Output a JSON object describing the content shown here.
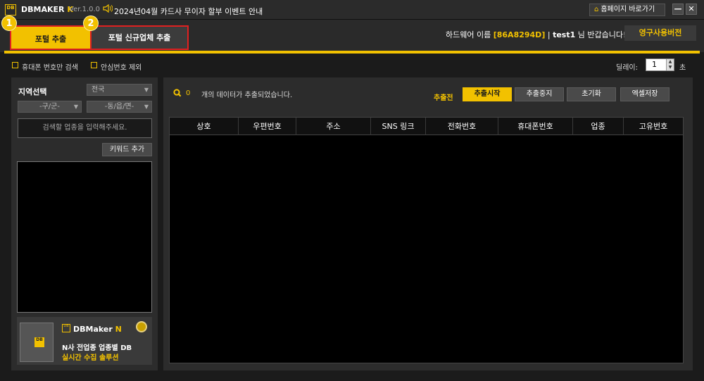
{
  "titlebar": {
    "logo": "DB",
    "app_name_prefix": "DBMAKER ",
    "app_name_suffix": "K",
    "version": "Ver.1.0.0",
    "notice_icon": "speaker-icon",
    "notice": "2024년04월 카드사 무이자 할부 이벤트 안내",
    "home_button": "홈페이지 바로가기",
    "minimize": "—",
    "close": "✕"
  },
  "tabs": {
    "extract_label": "포털 추출",
    "new_company_label": "포털 신규업체 추출",
    "badge1": "1",
    "badge2": "2"
  },
  "hardware": {
    "label": "하드웨어 이름",
    "id": "[86A8294D]",
    "separator": "|",
    "user": "test1",
    "greeting": "님 반갑습니다!",
    "permanent_button": "영구사용버전"
  },
  "options": {
    "mobile_only": "휴대폰 번호만 검색",
    "exclude_safe": "안심번호 제외",
    "delay_label": "딜레이:",
    "delay_value": "1",
    "delay_unit": "초"
  },
  "left": {
    "region_label": "지역선택",
    "sido": "전국",
    "gugun": "-구/군-",
    "dong": "-동/읍/면-",
    "keyword_placeholder": "검색할 업종을 입력해주세요.",
    "keyword_add": "키워드 추가",
    "ad": {
      "logo": "DB",
      "brand_prefix": "DBMaker ",
      "brand_suffix": "N",
      "line1": "N사 전업종 업종별 DB",
      "line2": "실시간 수집 솔루션"
    }
  },
  "right": {
    "count": "0",
    "count_text": "개의 데이터가 추출되었습니다.",
    "status": "추출전",
    "buttons": {
      "start": "추출시작",
      "stop": "추출중지",
      "reset": "초기화",
      "excel": "엑셀저장"
    },
    "columns": [
      "상호",
      "우편번호",
      "주소",
      "SNS 링크",
      "전화번호",
      "휴대폰번호",
      "업종",
      "고유번호"
    ]
  },
  "colors": {
    "accent": "#f2c100",
    "highlight_border": "#e02020",
    "background": "#1b1b1b",
    "panel": "#2c2c2c"
  }
}
